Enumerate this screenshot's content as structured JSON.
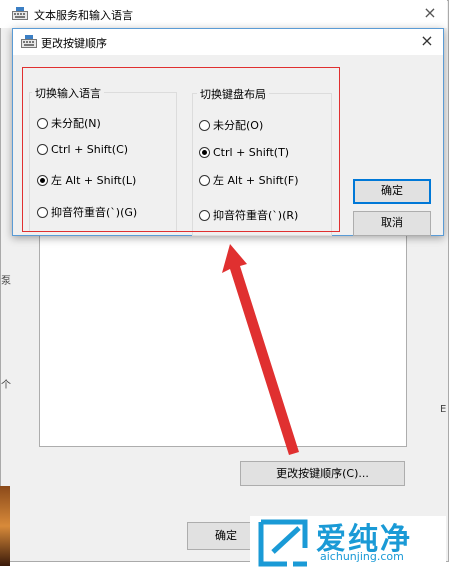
{
  "background_window": {
    "title": "文本服务和输入语言",
    "close_glyph": "×",
    "change_sequence_button": "更改按键顺序(C)...",
    "ok_button": "确定",
    "side_marks": [
      "泵",
      "个",
      "E"
    ]
  },
  "dialog": {
    "title": "更改按键顺序",
    "close_glyph": "×",
    "input_language_group": {
      "title": "切换输入语言",
      "options": [
        {
          "label": "未分配(N)",
          "selected": false
        },
        {
          "label": "Ctrl + Shift(C)",
          "selected": false
        },
        {
          "label": "左 Alt + Shift(L)",
          "selected": true
        },
        {
          "label": "抑音符重音(`)(G)",
          "selected": false
        }
      ]
    },
    "keyboard_layout_group": {
      "title": "切换键盘布局",
      "options": [
        {
          "label": "未分配(O)",
          "selected": false
        },
        {
          "label": "Ctrl + Shift(T)",
          "selected": true
        },
        {
          "label": "左 Alt + Shift(F)",
          "selected": false
        },
        {
          "label": "抑音符重音(`)(R)",
          "selected": false
        }
      ]
    },
    "ok_button": "确定",
    "cancel_button": "取消"
  },
  "watermark": {
    "brand": "爱纯净",
    "url": "aichunjing.com"
  },
  "colors": {
    "highlight": "#e03030",
    "arrow": "#e03030",
    "brand": "#1a9ad6",
    "accent": "#0078d7"
  }
}
